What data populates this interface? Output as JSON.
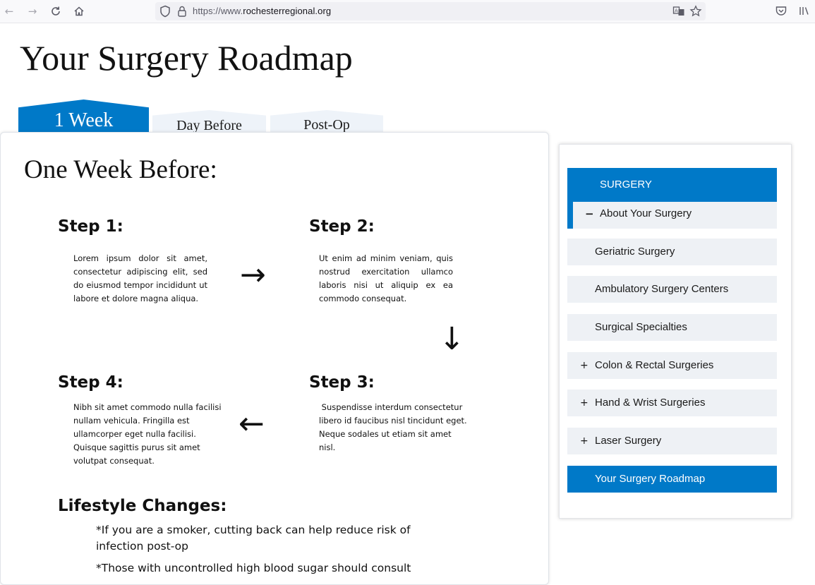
{
  "browser": {
    "url_prefix": "https://www.",
    "url_host": "rochesterregional.org",
    "icons": {
      "back": "arrow-left-icon",
      "forward": "arrow-right-icon",
      "reload": "reload-icon",
      "home": "home-icon",
      "tracking": "shield-icon",
      "lock": "lock-icon",
      "translate": "translate-icon",
      "bookmark": "star-icon",
      "pocket": "pocket-icon",
      "library": "library-icon"
    }
  },
  "page": {
    "title": "Your Surgery Roadmap",
    "tabs": [
      {
        "label": "1 Week",
        "active": true
      },
      {
        "label": "Day Before",
        "active": false
      },
      {
        "label": "Post-Op",
        "active": false
      }
    ],
    "section_title": "One Week Before:",
    "steps": [
      {
        "heading": "Step 1:",
        "text": "Lorem ipsum dolor sit amet, consectetur adipiscing elit, sed do eiusmod tempor incididunt ut labore et dolore magna aliqua."
      },
      {
        "heading": "Step 2:",
        "text": "Ut enim ad minim veniam, quis nostrud exercitation ullamco laboris nisi ut aliquip ex ea commodo consequat."
      },
      {
        "heading": "Step 3:",
        "text": " Suspendisse interdum consectetur libero id faucibus nisl tincidunt eget. Neque sodales ut etiam sit amet nisl."
      },
      {
        "heading": "Step 4:",
        "text": "Nibh sit amet commodo nulla facilisi nullam vehicula. Fringilla est ullamcorper eget nulla facilisi. Quisque sagittis purus sit amet volutpat consequat."
      }
    ],
    "arrows": {
      "right": "→",
      "down": "↓",
      "left": "←"
    },
    "lifestyle_heading": "Lifestyle Changes:",
    "lifestyle_items": [
      "*If you are a smoker, cutting back can help reduce risk of infection post-op",
      "*Those with uncontrolled high blood sugar should consult"
    ]
  },
  "sidebar": {
    "header": "SURGERY",
    "current": {
      "toggle": "−",
      "label": "About Your Surgery"
    },
    "items": [
      {
        "toggle": "",
        "label": "Geriatric Surgery"
      },
      {
        "toggle": "",
        "label": "Ambulatory Surgery Centers"
      },
      {
        "toggle": "",
        "label": "Surgical Specialties"
      },
      {
        "toggle": "+",
        "label": "Colon & Rectal Surgeries"
      },
      {
        "toggle": "+",
        "label": "Hand & Wrist Surgeries"
      },
      {
        "toggle": "+",
        "label": "Laser Surgery"
      },
      {
        "toggle": "",
        "label": "Your Surgery Roadmap"
      }
    ]
  },
  "colors": {
    "accent": "#0079c8",
    "tab_inactive": "#eef3f9",
    "menu_bg": "#eef1f5"
  }
}
